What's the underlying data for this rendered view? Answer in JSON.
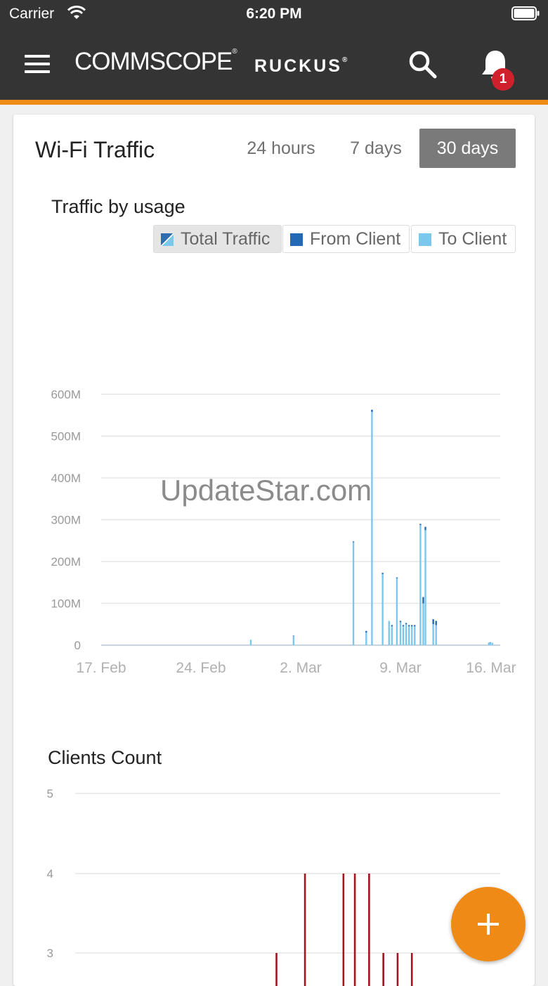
{
  "status_bar": {
    "carrier": "Carrier",
    "time": "6:20 PM"
  },
  "header": {
    "logo_primary": "COMMSCOPE",
    "logo_secondary": "RUCKUS",
    "notification_count": "1"
  },
  "card": {
    "title": "Wi-Fi Traffic",
    "ranges": [
      "24 hours",
      "7 days",
      "30 days"
    ],
    "selected_range": "30 days"
  },
  "watermark": "UpdateStar.com",
  "colors": {
    "accent": "#f08a16",
    "header_bg": "#343434",
    "from_client": "#2369b6",
    "to_client": "#7cc8ec",
    "clients_bar": "#a01621",
    "badge": "#d0202b"
  },
  "chart_data": [
    {
      "type": "bar",
      "title": "Traffic by usage",
      "legend": [
        "Total Traffic",
        "From Client",
        "To Client"
      ],
      "legend_placement": "top-right",
      "x_tick_labels": [
        "17. Feb",
        "24. Feb",
        "2. Mar",
        "9. Mar",
        "16. Mar"
      ],
      "y_tick_labels": [
        "0",
        "100M",
        "200M",
        "300M",
        "400M",
        "500M",
        "600M"
      ],
      "ylim": [
        0,
        600
      ],
      "y_unit_millions": true,
      "grid": true,
      "x_range_days": [
        0,
        28
      ],
      "series": [
        {
          "name": "From Client",
          "points": [
            [
              10.5,
              0.5
            ],
            [
              13.5,
              1
            ],
            [
              17.7,
              2
            ],
            [
              18.6,
              4
            ],
            [
              19.0,
              5
            ],
            [
              19.75,
              3
            ],
            [
              20.2,
              0
            ],
            [
              20.4,
              3
            ],
            [
              20.75,
              2
            ],
            [
              21.0,
              3
            ],
            [
              21.2,
              3
            ],
            [
              21.4,
              3
            ],
            [
              21.6,
              3
            ],
            [
              21.8,
              3
            ],
            [
              22.0,
              3
            ],
            [
              22.4,
              3
            ],
            [
              22.6,
              15
            ],
            [
              22.75,
              8
            ],
            [
              23.3,
              12
            ],
            [
              23.5,
              10
            ],
            [
              27.2,
              0.5
            ],
            [
              27.3,
              1
            ],
            [
              27.45,
              0.5
            ]
          ]
        },
        {
          "name": "To Client",
          "points": [
            [
              10.5,
              12
            ],
            [
              13.5,
              22
            ],
            [
              17.7,
              246
            ],
            [
              18.6,
              30
            ],
            [
              19.0,
              558
            ],
            [
              19.75,
              170
            ],
            [
              20.2,
              58
            ],
            [
              20.4,
              45
            ],
            [
              20.75,
              160
            ],
            [
              21.0,
              55
            ],
            [
              21.2,
              45
            ],
            [
              21.4,
              50
            ],
            [
              21.6,
              45
            ],
            [
              21.8,
              45
            ],
            [
              22.0,
              45
            ],
            [
              22.4,
              287
            ],
            [
              22.6,
              100
            ],
            [
              22.75,
              275
            ],
            [
              23.3,
              50
            ],
            [
              23.5,
              48
            ],
            [
              27.2,
              5
            ],
            [
              27.3,
              6
            ],
            [
              27.45,
              5
            ]
          ]
        }
      ]
    },
    {
      "type": "bar",
      "title": "Clients Count",
      "y_tick_labels": [
        "3",
        "4",
        "5"
      ],
      "ylim_visible": [
        3,
        5
      ],
      "grid": true,
      "series": [
        {
          "name": "Clients",
          "points": [
            [
              12.3,
              3
            ],
            [
              14.3,
              4
            ],
            [
              17.0,
              4
            ],
            [
              17.8,
              4
            ],
            [
              18.8,
              4
            ],
            [
              19.8,
              3
            ],
            [
              20.8,
              3
            ],
            [
              21.8,
              3
            ]
          ]
        }
      ]
    }
  ]
}
